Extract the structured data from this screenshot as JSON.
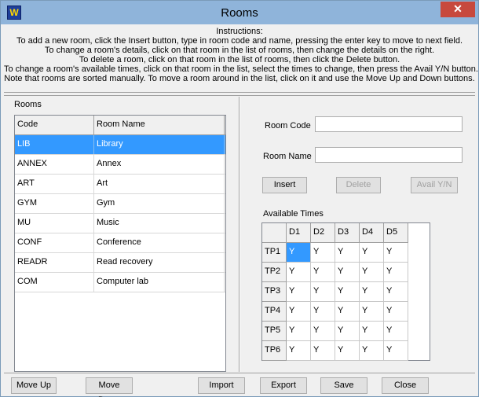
{
  "window": {
    "title": "Rooms",
    "close_glyph": "✕"
  },
  "instructions": {
    "heading": "Instructions:",
    "lines": [
      "To add a new room, click the Insert button, type in room code and name, pressing the enter key to move to next field.",
      "To change a room's details, click on that room in the list of rooms, then change the details on the right.",
      "To delete a room, click on that room in the list of rooms, then click the Delete button.",
      "To change a room's available times, click on that room in the list, select the times to change, then press the Avail Y/N button.",
      "Note that rooms are sorted manually.  To move a room around in the list, click on it and use the Move Up and Down buttons."
    ]
  },
  "rooms": {
    "label": "Rooms",
    "columns": [
      "Code",
      "Room Name"
    ],
    "rows": [
      {
        "code": "LIB",
        "name": "Library"
      },
      {
        "code": "ANNEX",
        "name": "Annex"
      },
      {
        "code": "ART",
        "name": "Art"
      },
      {
        "code": "GYM",
        "name": "Gym"
      },
      {
        "code": "MU",
        "name": "Music"
      },
      {
        "code": "CONF",
        "name": "Conference"
      },
      {
        "code": "READR",
        "name": "Read recovery"
      },
      {
        "code": "COM",
        "name": "Computer lab"
      }
    ],
    "selected_index": 0
  },
  "details": {
    "room_code_label": "Room Code",
    "room_code_value": "",
    "room_name_label": "Room Name",
    "room_name_value": "",
    "insert_label": "Insert",
    "delete_label": "Delete",
    "avail_label": "Avail Y/N"
  },
  "available_times": {
    "label": "Available Times",
    "days": [
      "D1",
      "D2",
      "D3",
      "D4",
      "D5"
    ],
    "periods": [
      "TP1",
      "TP2",
      "TP3",
      "TP4",
      "TP5",
      "TP6"
    ],
    "values": [
      [
        "Y",
        "Y",
        "Y",
        "Y",
        "Y"
      ],
      [
        "Y",
        "Y",
        "Y",
        "Y",
        "Y"
      ],
      [
        "Y",
        "Y",
        "Y",
        "Y",
        "Y"
      ],
      [
        "Y",
        "Y",
        "Y",
        "Y",
        "Y"
      ],
      [
        "Y",
        "Y",
        "Y",
        "Y",
        "Y"
      ],
      [
        "Y",
        "Y",
        "Y",
        "Y",
        "Y"
      ]
    ]
  },
  "footer": {
    "move_up": "Move Up",
    "move_down": "Move Down",
    "import": "Import",
    "export": "Export",
    "save": "Save",
    "close": "Close"
  },
  "colors": {
    "selection": "#3399ff",
    "titlebar": "#8fb4da",
    "close_button": "#c7493d"
  }
}
